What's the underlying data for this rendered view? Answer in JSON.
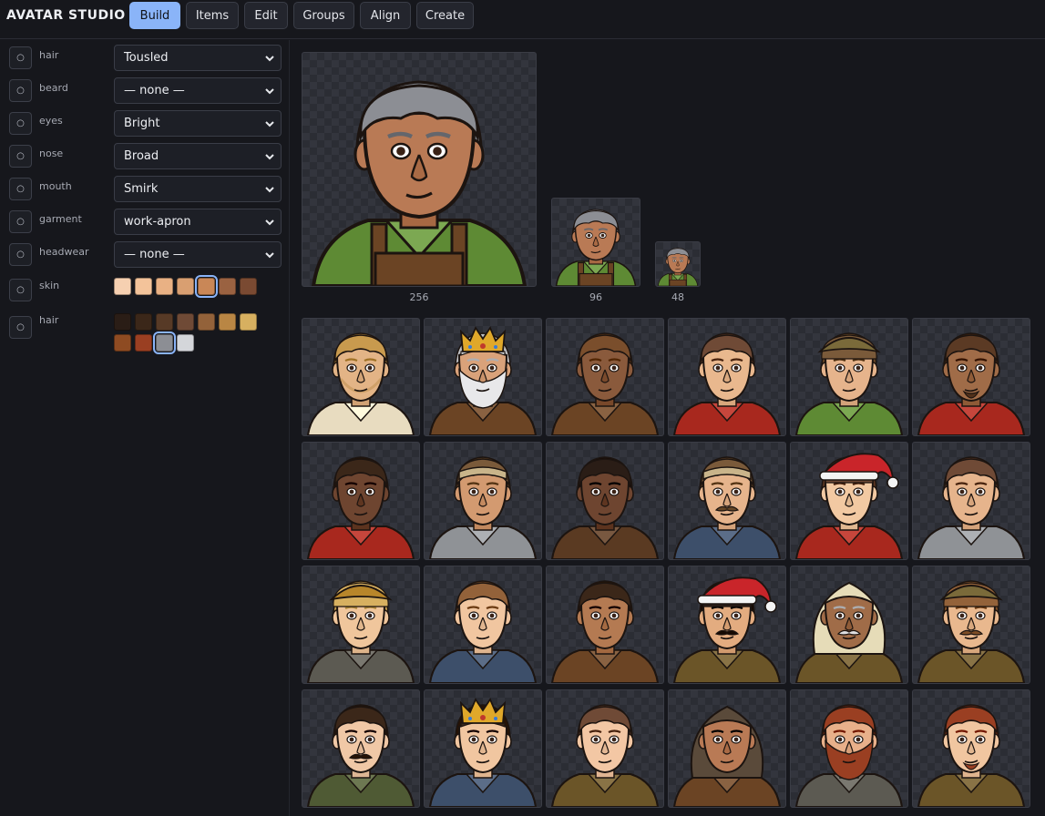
{
  "app": {
    "title": "AVATAR STUDIO"
  },
  "tabs": [
    {
      "label": "Build",
      "active": true
    },
    {
      "label": "Items"
    },
    {
      "label": "Edit"
    },
    {
      "label": "Groups"
    },
    {
      "label": "Align"
    },
    {
      "label": "Create"
    }
  ],
  "controls": {
    "toggle_glyph": "○",
    "rows": [
      {
        "label": "hair",
        "value": "Tousled"
      },
      {
        "label": "beard",
        "value": "— none —"
      },
      {
        "label": "eyes",
        "value": "Bright"
      },
      {
        "label": "nose",
        "value": "Broad"
      },
      {
        "label": "mouth",
        "value": "Smirk"
      },
      {
        "label": "garment",
        "value": "work-apron"
      },
      {
        "label": "headwear",
        "value": "— none —"
      }
    ],
    "skin": {
      "label": "skin",
      "colors": [
        "#f6d0b1",
        "#f3c39a",
        "#e9b184",
        "#d99f71",
        "#c98757",
        "#9a6241",
        "#7a4a32"
      ],
      "selected": 4
    },
    "hair_color": {
      "label": "hair",
      "colors": [
        "#2a1d16",
        "#3b2719",
        "#573a26",
        "#6f4a36",
        "#93623a",
        "#b98644",
        "#d7b060",
        "#8e4b22",
        "#9a3f22",
        "#8c8e94",
        "#d4d6da"
      ],
      "selected": 9
    }
  },
  "preview": {
    "sizes": [
      "256",
      "96",
      "48"
    ],
    "current": {
      "skin": "#b97a55",
      "hair": "#8c8e94",
      "shirt": "#5e8a34",
      "strap": "#6b4424",
      "hat": "none",
      "beard": "none"
    }
  },
  "gallery": [
    {
      "skin": "#e3b486",
      "hair": "#c89a4e",
      "shirt": "#e8dcc0",
      "hat": "none",
      "beard": "stubble"
    },
    {
      "skin": "#d9a27a",
      "hair": "#d4d6da",
      "shirt": "#6b4424",
      "hat": "crown",
      "beard": "full-white"
    },
    {
      "skin": "#8a5a3c",
      "hair": "#7a4e2c",
      "shirt": "#6b4424",
      "hat": "none",
      "beard": "none"
    },
    {
      "skin": "#e9b88e",
      "hair": "#6f4a36",
      "shirt": "#a8281e",
      "hat": "none",
      "beard": "none"
    },
    {
      "skin": "#e6b48c",
      "hair": "#7a5a3a",
      "shirt": "#5e8a34",
      "hat": "cap",
      "beard": "none"
    },
    {
      "skin": "#a06c48",
      "hair": "#5b3a24",
      "shirt": "#a8281e",
      "hat": "none",
      "beard": "goatee"
    },
    {
      "skin": "#6e4530",
      "hair": "#3b2719",
      "shirt": "#a8281e",
      "hat": "none",
      "beard": "none"
    },
    {
      "skin": "#d39a70",
      "hair": "#7a5a3a",
      "shirt": "#8f9296",
      "hat": "headband",
      "beard": "none"
    },
    {
      "skin": "#6e4530",
      "hair": "#2a1d16",
      "shirt": "#5a3a22",
      "hat": "none",
      "beard": "none"
    },
    {
      "skin": "#e6b48c",
      "hair": "#7a5a3a",
      "shirt": "#3d4f6a",
      "hat": "headband",
      "beard": "moustache"
    },
    {
      "skin": "#f2c9a2",
      "hair": "#6f4a36",
      "shirt": "#a8281e",
      "hat": "santa",
      "beard": "none"
    },
    {
      "skin": "#e6b48c",
      "hair": "#6f4a36",
      "shirt": "#8f9296",
      "hat": "none",
      "beard": "none"
    },
    {
      "skin": "#f0c69c",
      "hair": "#d7b060",
      "shirt": "#5c5a52",
      "hat": "beret",
      "beard": "none"
    },
    {
      "skin": "#f1c6a0",
      "hair": "#93623a",
      "shirt": "#3d4f6a",
      "hat": "none",
      "beard": "none"
    },
    {
      "skin": "#b47a52",
      "hair": "#3b2719",
      "shirt": "#6b4424",
      "hat": "none",
      "beard": "none"
    },
    {
      "skin": "#e3ac80",
      "hair": "#2a1d16",
      "shirt": "#6b5528",
      "hat": "santa",
      "beard": "moustache"
    },
    {
      "skin": "#a06c48",
      "hair": "#d4d6da",
      "shirt": "#6b5528",
      "hat": "hood",
      "beard": "moustache-white"
    },
    {
      "skin": "#e9b88e",
      "hair": "#93623a",
      "shirt": "#6b5528",
      "hat": "cap",
      "beard": "moustache"
    },
    {
      "skin": "#f0c8a6",
      "hair": "#3b2719",
      "shirt": "#4f5a34",
      "hat": "none",
      "beard": "moustache"
    },
    {
      "skin": "#f1c6a0",
      "hair": "#3b2719",
      "shirt": "#3d4f6a",
      "hat": "crown",
      "beard": "none"
    },
    {
      "skin": "#f3c7a4",
      "hair": "#6f4a36",
      "shirt": "#6b5528",
      "hat": "none",
      "beard": "none"
    },
    {
      "skin": "#b97a55",
      "hair": "#2a1d16",
      "shirt": "#6b4424",
      "hat": "hood",
      "beard": "none"
    },
    {
      "skin": "#e8b08a",
      "hair": "#9a3f22",
      "shirt": "#5c5a52",
      "hat": "none",
      "beard": "full-red"
    },
    {
      "skin": "#f1c6a0",
      "hair": "#9a3f22",
      "shirt": "#6b5528",
      "hat": "none",
      "beard": "goatee-red"
    }
  ]
}
